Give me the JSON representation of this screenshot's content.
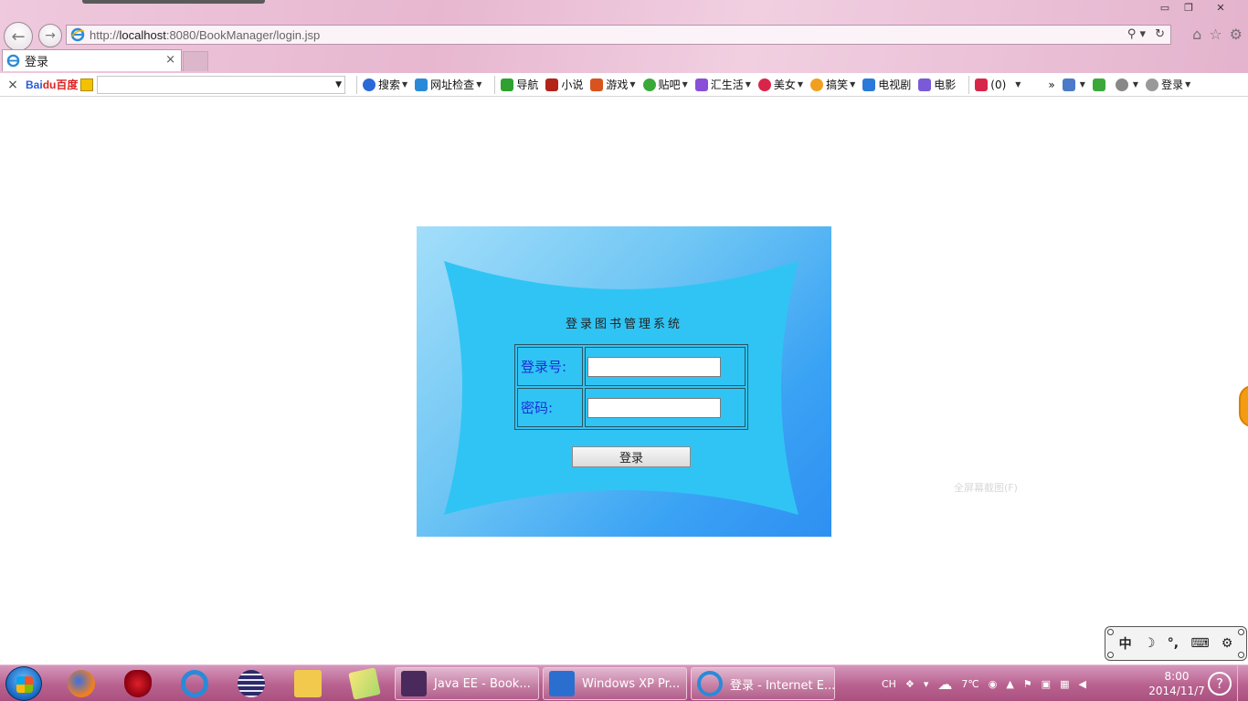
{
  "browser": {
    "url_prefix": "http://",
    "url_host": "localhost",
    "url_rest": ":8080/BookManager/login.jsp",
    "tab_title": "登录",
    "tab_close": "×",
    "window_controls": {
      "minimize": "▭",
      "restore": "❐",
      "close": "✕"
    },
    "address_tools": {
      "search": "⚲ ▾",
      "refresh": "↻"
    },
    "chrome_icons": {
      "home": "⌂",
      "favorites": "☆",
      "tools": "⚙"
    }
  },
  "toolbar": {
    "close": "×",
    "brand_bai": "Bai",
    "brand_du": "du百度",
    "items": [
      {
        "label": "搜索",
        "color": "#2a6ad8"
      },
      {
        "label": "网址检查",
        "color": "#2a8ad8"
      },
      {
        "label": "导航",
        "color": "#2fa12f"
      },
      {
        "label": "小说",
        "color": "#b3231a"
      },
      {
        "label": "游戏",
        "color": "#d9531e"
      },
      {
        "label": "贴吧",
        "color": "#3aa93a"
      },
      {
        "label": "汇生活",
        "color": "#8a4fd8"
      },
      {
        "label": "美女",
        "color": "#d8264a"
      },
      {
        "label": "搞笑",
        "color": "#f0a020"
      },
      {
        "label": "电视剧",
        "color": "#2a7ad8"
      },
      {
        "label": "电影",
        "color": "#7a5ad8"
      }
    ],
    "mail_count": "(0)",
    "login_label": "登录",
    "more": "»"
  },
  "login": {
    "title": "登录图书管理系统",
    "username_label": "登录号:",
    "password_label": "密码:",
    "username_value": "",
    "password_value": "",
    "submit_label": "登录"
  },
  "page_faint_text": "全屏幕截图(F)",
  "ime": {
    "mode": "中",
    "moon": "☽",
    "punct": "°,",
    "keyboard": "⌨",
    "settings": "⚙"
  },
  "taskbar": {
    "tasks": [
      {
        "label": "Java EE - Book...",
        "color": "#4a2a5c"
      },
      {
        "label": "Windows XP Pr...",
        "color": "#2a6fcf"
      },
      {
        "label": "登录 - Internet E...",
        "color": "#2a8ad8"
      }
    ],
    "tray_lang": "CH",
    "temperature": "7℃",
    "time": "8:00",
    "date": "2014/11/7",
    "help": "?"
  }
}
